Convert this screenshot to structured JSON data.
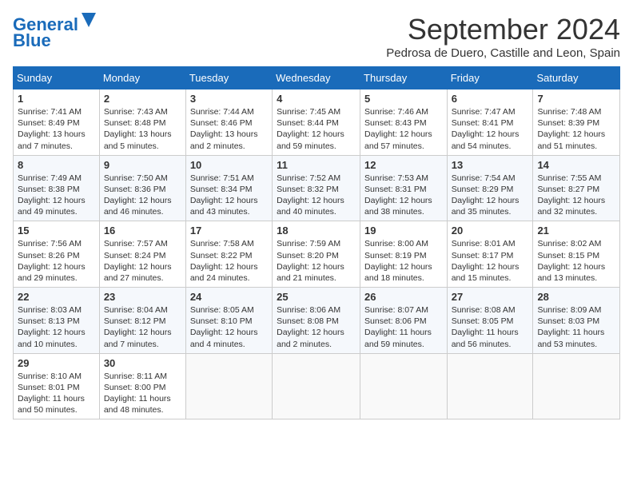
{
  "header": {
    "logo_line1": "General",
    "logo_line2": "Blue",
    "month": "September 2024",
    "location": "Pedrosa de Duero, Castille and Leon, Spain"
  },
  "weekdays": [
    "Sunday",
    "Monday",
    "Tuesday",
    "Wednesday",
    "Thursday",
    "Friday",
    "Saturday"
  ],
  "weeks": [
    [
      {
        "day": "1",
        "info": "Sunrise: 7:41 AM\nSunset: 8:49 PM\nDaylight: 13 hours\nand 7 minutes."
      },
      {
        "day": "2",
        "info": "Sunrise: 7:43 AM\nSunset: 8:48 PM\nDaylight: 13 hours\nand 5 minutes."
      },
      {
        "day": "3",
        "info": "Sunrise: 7:44 AM\nSunset: 8:46 PM\nDaylight: 13 hours\nand 2 minutes."
      },
      {
        "day": "4",
        "info": "Sunrise: 7:45 AM\nSunset: 8:44 PM\nDaylight: 12 hours\nand 59 minutes."
      },
      {
        "day": "5",
        "info": "Sunrise: 7:46 AM\nSunset: 8:43 PM\nDaylight: 12 hours\nand 57 minutes."
      },
      {
        "day": "6",
        "info": "Sunrise: 7:47 AM\nSunset: 8:41 PM\nDaylight: 12 hours\nand 54 minutes."
      },
      {
        "day": "7",
        "info": "Sunrise: 7:48 AM\nSunset: 8:39 PM\nDaylight: 12 hours\nand 51 minutes."
      }
    ],
    [
      {
        "day": "8",
        "info": "Sunrise: 7:49 AM\nSunset: 8:38 PM\nDaylight: 12 hours\nand 49 minutes."
      },
      {
        "day": "9",
        "info": "Sunrise: 7:50 AM\nSunset: 8:36 PM\nDaylight: 12 hours\nand 46 minutes."
      },
      {
        "day": "10",
        "info": "Sunrise: 7:51 AM\nSunset: 8:34 PM\nDaylight: 12 hours\nand 43 minutes."
      },
      {
        "day": "11",
        "info": "Sunrise: 7:52 AM\nSunset: 8:32 PM\nDaylight: 12 hours\nand 40 minutes."
      },
      {
        "day": "12",
        "info": "Sunrise: 7:53 AM\nSunset: 8:31 PM\nDaylight: 12 hours\nand 38 minutes."
      },
      {
        "day": "13",
        "info": "Sunrise: 7:54 AM\nSunset: 8:29 PM\nDaylight: 12 hours\nand 35 minutes."
      },
      {
        "day": "14",
        "info": "Sunrise: 7:55 AM\nSunset: 8:27 PM\nDaylight: 12 hours\nand 32 minutes."
      }
    ],
    [
      {
        "day": "15",
        "info": "Sunrise: 7:56 AM\nSunset: 8:26 PM\nDaylight: 12 hours\nand 29 minutes."
      },
      {
        "day": "16",
        "info": "Sunrise: 7:57 AM\nSunset: 8:24 PM\nDaylight: 12 hours\nand 27 minutes."
      },
      {
        "day": "17",
        "info": "Sunrise: 7:58 AM\nSunset: 8:22 PM\nDaylight: 12 hours\nand 24 minutes."
      },
      {
        "day": "18",
        "info": "Sunrise: 7:59 AM\nSunset: 8:20 PM\nDaylight: 12 hours\nand 21 minutes."
      },
      {
        "day": "19",
        "info": "Sunrise: 8:00 AM\nSunset: 8:19 PM\nDaylight: 12 hours\nand 18 minutes."
      },
      {
        "day": "20",
        "info": "Sunrise: 8:01 AM\nSunset: 8:17 PM\nDaylight: 12 hours\nand 15 minutes."
      },
      {
        "day": "21",
        "info": "Sunrise: 8:02 AM\nSunset: 8:15 PM\nDaylight: 12 hours\nand 13 minutes."
      }
    ],
    [
      {
        "day": "22",
        "info": "Sunrise: 8:03 AM\nSunset: 8:13 PM\nDaylight: 12 hours\nand 10 minutes."
      },
      {
        "day": "23",
        "info": "Sunrise: 8:04 AM\nSunset: 8:12 PM\nDaylight: 12 hours\nand 7 minutes."
      },
      {
        "day": "24",
        "info": "Sunrise: 8:05 AM\nSunset: 8:10 PM\nDaylight: 12 hours\nand 4 minutes."
      },
      {
        "day": "25",
        "info": "Sunrise: 8:06 AM\nSunset: 8:08 PM\nDaylight: 12 hours\nand 2 minutes."
      },
      {
        "day": "26",
        "info": "Sunrise: 8:07 AM\nSunset: 8:06 PM\nDaylight: 11 hours\nand 59 minutes."
      },
      {
        "day": "27",
        "info": "Sunrise: 8:08 AM\nSunset: 8:05 PM\nDaylight: 11 hours\nand 56 minutes."
      },
      {
        "day": "28",
        "info": "Sunrise: 8:09 AM\nSunset: 8:03 PM\nDaylight: 11 hours\nand 53 minutes."
      }
    ],
    [
      {
        "day": "29",
        "info": "Sunrise: 8:10 AM\nSunset: 8:01 PM\nDaylight: 11 hours\nand 50 minutes."
      },
      {
        "day": "30",
        "info": "Sunrise: 8:11 AM\nSunset: 8:00 PM\nDaylight: 11 hours\nand 48 minutes."
      },
      {
        "day": "",
        "info": ""
      },
      {
        "day": "",
        "info": ""
      },
      {
        "day": "",
        "info": ""
      },
      {
        "day": "",
        "info": ""
      },
      {
        "day": "",
        "info": ""
      }
    ]
  ]
}
